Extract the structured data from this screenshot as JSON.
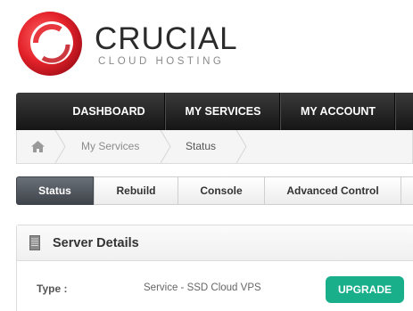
{
  "brand": {
    "name": "CRUCIAL",
    "tagline": "CLOUD HOSTING",
    "accent_color": "#e4222a"
  },
  "nav": {
    "items": [
      {
        "label": "DASHBOARD"
      },
      {
        "label": "MY SERVICES"
      },
      {
        "label": "MY ACCOUNT"
      }
    ]
  },
  "breadcrumb": {
    "home_icon": "home-icon",
    "items": [
      {
        "label": "My Services"
      },
      {
        "label": "Status"
      }
    ]
  },
  "tabs": [
    {
      "label": "Status",
      "active": true
    },
    {
      "label": "Rebuild"
    },
    {
      "label": "Console"
    },
    {
      "label": "Advanced Control"
    }
  ],
  "panel": {
    "icon": "server-icon",
    "title": "Server Details",
    "rows": [
      {
        "label": "Type :",
        "value": "Service - SSD Cloud VPS"
      }
    ],
    "upgrade_label": "UPGRADE",
    "upgrade_color": "#1aaf8b"
  }
}
